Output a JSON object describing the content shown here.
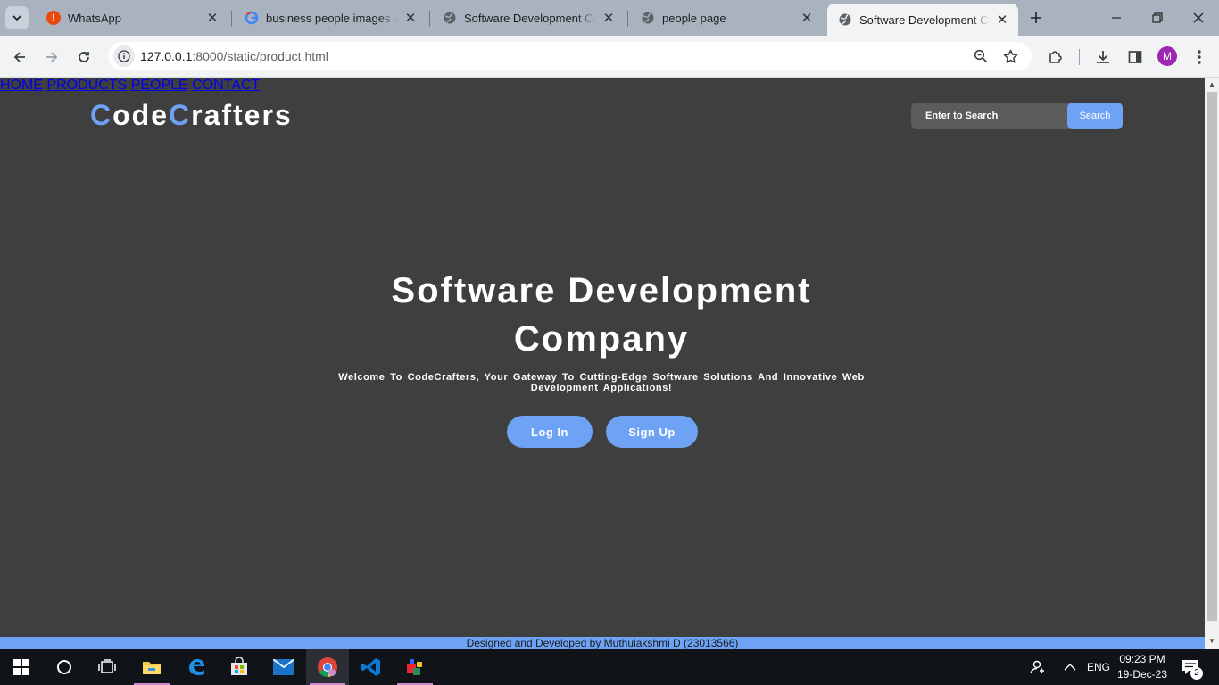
{
  "browser": {
    "tabs": [
      {
        "title": "WhatsApp",
        "icon": "whatsapp-alert-icon"
      },
      {
        "title": "business people images - Go",
        "icon": "google-icon"
      },
      {
        "title": "Software Development Comp",
        "icon": "globe-icon"
      },
      {
        "title": "people page",
        "icon": "globe-icon"
      },
      {
        "title": "Software Development Comp",
        "icon": "globe-icon",
        "active": true
      }
    ],
    "url_host": "127.0.0.1",
    "url_rest": ":8000/static/product.html",
    "profile_initial": "M"
  },
  "site": {
    "logo": {
      "c1": "C",
      "part1": "ode",
      "c2": "C",
      "part2": "rafters"
    },
    "nav": [
      "HOME",
      "PRODUCTS",
      "PEOPLE",
      "CONTACT"
    ],
    "search": {
      "placeholder": "Enter to Search",
      "button": "Search"
    },
    "hero": {
      "title": "Software Development Company",
      "subtitle": "Welcome To CodeCrafters, Your Gateway To Cutting-Edge Software Solutions And Innovative Web Development Applications!",
      "login": "Log In",
      "signup": "Sign Up"
    },
    "footer": "Designed and Developed by Muthulakshmi D (23013566)",
    "colors": {
      "accent": "#6ea2f5",
      "background": "#3f3f3f"
    }
  },
  "taskbar": {
    "language": "ENG",
    "time": "09:23 PM",
    "date": "19-Dec-23",
    "notifications": "2"
  }
}
